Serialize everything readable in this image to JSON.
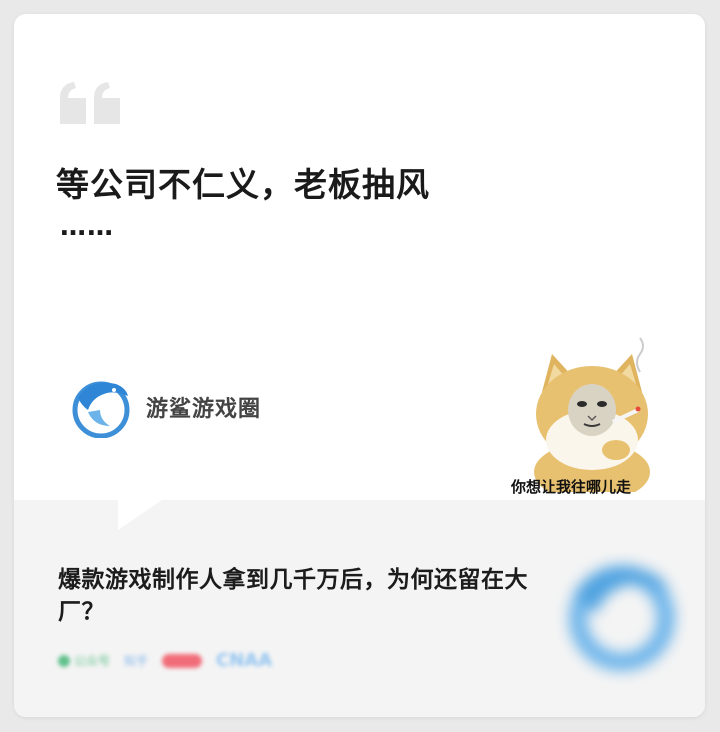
{
  "quote": {
    "icon": "quote-mark-icon",
    "headline": "等公司不仁义，老板抽风",
    "ellipsis": "……"
  },
  "brand": {
    "icon": "shark-logo-icon",
    "name": "游鲨游戏圈"
  },
  "meme": {
    "caption": "你想让我往哪儿走"
  },
  "recommendation": {
    "title": "爆款游戏制作人拿到几千万后，为何还留在大厂？",
    "sources": [
      {
        "type": "wechat-icon",
        "label": "公众号"
      },
      {
        "type": "text",
        "label": "知乎"
      },
      {
        "type": "pill",
        "label": ""
      },
      {
        "type": "text-big",
        "label": "CNAA"
      }
    ]
  },
  "colors": {
    "background": "#e9e9e9",
    "card": "#ffffff",
    "bottom_panel": "#f4f4f4",
    "brand_blue": "#3d8fd8",
    "quote_gray": "#e6e6e6"
  }
}
